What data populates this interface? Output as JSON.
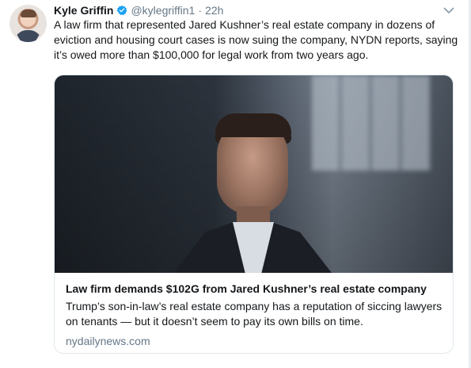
{
  "tweet": {
    "author": {
      "display_name": "Kyle Griffin",
      "handle": "@kylegriffin1",
      "separator": "·",
      "time": "22h"
    },
    "text": "A law firm that represented Jared Kushner’s real estate company in dozens of eviction and housing court cases is now suing the company, NYDN reports, saying it’s owed more than $100,000 for legal work from two years ago."
  },
  "card": {
    "title": "Law firm demands $102G from Jared Kushner’s real estate company",
    "description": "Trump’s son-in-law’s real estate company has a reputation of siccing lawyers on tenants — but it doesn’t seem to pay its own bills on time.",
    "domain": "nydailynews.com"
  },
  "icons": {
    "verified": "verified-badge-icon",
    "more": "chevron-down-icon"
  },
  "colors": {
    "text": "#14171a",
    "secondary": "#657786",
    "verified": "#1da1f2",
    "border": "#e1e8ed"
  }
}
